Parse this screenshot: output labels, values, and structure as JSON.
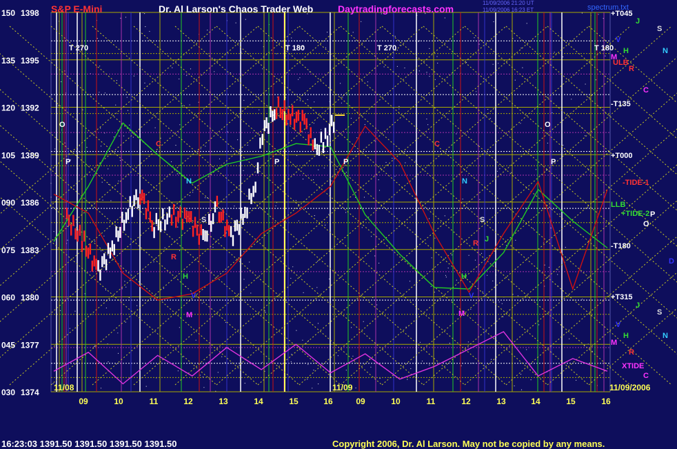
{
  "header": {
    "ticker": "S&P E-Mini",
    "title": "Dr. Al Larson's Chaos Trader Web",
    "site": "Daytradingforecasts.com",
    "stamp1": "11/09/2006 21:20 UT",
    "stamp2": "11/09/2006 16:23 ET",
    "spectrum": "spectrum.txt"
  },
  "footer": {
    "quote": "16:23:03  1391.50  1391.50  1391.50  1391.50",
    "copyright": "Copyright 2006, Dr. Al Larson. May not be copied by any means."
  },
  "colors": {
    "background": "#0e0e5c",
    "grid": "#aaaa00",
    "price_up": "#ffffff",
    "price_down": "#ff0000",
    "green_flux": "#22cc22",
    "red_flux": "#cc1111",
    "cycle": "#dd33dd"
  },
  "chart_data": {
    "type": "line",
    "title": "S&P E-Mini",
    "xlabel": "",
    "ylabel": "",
    "ylim": [
      1374,
      1398
    ],
    "y_ticks": [
      {
        "osc": "150",
        "price": "1398",
        "value": 1398
      },
      {
        "osc": "135",
        "price": "1395",
        "value": 1395
      },
      {
        "osc": "120",
        "price": "1392",
        "value": 1392
      },
      {
        "osc": "105",
        "price": "1389",
        "value": 1389
      },
      {
        "osc": "090",
        "price": "1386",
        "value": 1386
      },
      {
        "osc": "075",
        "price": "1383",
        "value": 1383
      },
      {
        "osc": "060",
        "price": "1380",
        "value": 1380
      },
      {
        "osc": "045",
        "price": "1377",
        "value": 1377
      },
      {
        "osc": "030",
        "price": "1374",
        "value": 1374
      }
    ],
    "x_ticks": [
      "09",
      "10",
      "11",
      "12",
      "13",
      "14",
      "15",
      "16",
      "09",
      "10",
      "11",
      "12",
      "13",
      "14",
      "15",
      "16"
    ],
    "date_labels": [
      "11/08",
      "11/09",
      "11/09/2006"
    ],
    "price_series": [
      {
        "day": "11/08",
        "hour": 8.5,
        "price": 1385.0
      },
      {
        "day": "11/08",
        "hour": 9.0,
        "price": 1383.4
      },
      {
        "day": "11/08",
        "hour": 9.4,
        "price": 1381.6
      },
      {
        "day": "11/08",
        "hour": 9.8,
        "price": 1383.1
      },
      {
        "day": "11/08",
        "hour": 10.2,
        "price": 1385.2
      },
      {
        "day": "11/08",
        "hour": 10.6,
        "price": 1386.6
      },
      {
        "day": "11/08",
        "hour": 11.0,
        "price": 1384.5
      },
      {
        "day": "11/08",
        "hour": 11.5,
        "price": 1385.1
      },
      {
        "day": "11/08",
        "hour": 12.0,
        "price": 1385.0
      },
      {
        "day": "11/08",
        "hour": 12.4,
        "price": 1383.6
      },
      {
        "day": "11/08",
        "hour": 12.8,
        "price": 1385.6
      },
      {
        "day": "11/08",
        "hour": 13.2,
        "price": 1383.8
      },
      {
        "day": "11/08",
        "hour": 13.6,
        "price": 1385.3
      },
      {
        "day": "11/08",
        "hour": 13.9,
        "price": 1387.2
      },
      {
        "day": "11/08",
        "hour": 14.1,
        "price": 1390.4
      },
      {
        "day": "11/08",
        "hour": 14.5,
        "price": 1392.0
      },
      {
        "day": "11/08",
        "hour": 14.9,
        "price": 1391.4
      },
      {
        "day": "11/08",
        "hour": 15.3,
        "price": 1391.1
      },
      {
        "day": "11/08",
        "hour": 15.6,
        "price": 1389.3
      },
      {
        "day": "11/08",
        "hour": 15.9,
        "price": 1389.9
      },
      {
        "day": "11/08",
        "hour": 16.2,
        "price": 1391.5
      }
    ],
    "series": [
      {
        "name": "",
        "color": "#22cc22",
        "values": [
          1383.5,
          1387.0,
          1391.0,
          1389.0,
          1387.2,
          1388.4,
          1388.9,
          1389.7,
          1389.5,
          1385.2,
          1382.7,
          1380.6,
          1380.5,
          1382.8,
          1386.8,
          1384.8,
          1383.1
        ]
      },
      {
        "name": "",
        "color": "#cc1111",
        "values": [
          1386.5,
          1385.3,
          1381.5,
          1379.8,
          1380.2,
          1381.5,
          1384.0,
          1385.3,
          1387.0,
          1390.8,
          1388.5,
          1384.0,
          1380.3,
          1384.0,
          1387.3,
          1380.5,
          1386.8
        ]
      },
      {
        "name": "",
        "color": "#dd33dd",
        "values": [
          1375.3,
          1376.5,
          1374.5,
          1376.3,
          1375.0,
          1376.8,
          1375.4,
          1377.0,
          1375.2,
          1376.4,
          1374.8,
          1375.6,
          1376.7,
          1377.8,
          1375.0,
          1376.1,
          1375.3
        ]
      }
    ],
    "annotations": [
      {
        "text": "T 270",
        "color": "#ffffff"
      },
      {
        "text": "T 180",
        "color": "#ffffff"
      },
      {
        "text": "T 270",
        "color": "#ffffff"
      },
      {
        "text": "T 180",
        "color": "#ffffff"
      },
      {
        "text": "O",
        "color": "#ffffff"
      },
      {
        "text": "P",
        "color": "#ffffff"
      },
      {
        "text": "C",
        "color": "#ff3333"
      },
      {
        "text": "N",
        "color": "#33ccff"
      },
      {
        "text": "S",
        "color": "#dddddd"
      },
      {
        "text": "R",
        "color": "#ff3333"
      },
      {
        "text": "H",
        "color": "#33dd33"
      },
      {
        "text": "V",
        "color": "#3333ff"
      },
      {
        "text": "M",
        "color": "#ff33ff"
      },
      {
        "text": "P",
        "color": "#ffffff"
      },
      {
        "text": "P",
        "color": "#ffffff"
      },
      {
        "text": "C",
        "color": "#ff3333"
      },
      {
        "text": "N",
        "color": "#33ccff"
      },
      {
        "text": "S",
        "color": "#dddddd"
      },
      {
        "text": "R",
        "color": "#ff3333"
      },
      {
        "text": "J",
        "color": "#33dd33"
      },
      {
        "text": "H",
        "color": "#33dd33"
      },
      {
        "text": "V",
        "color": "#3333ff"
      },
      {
        "text": "M",
        "color": "#ff33ff"
      },
      {
        "text": "O",
        "color": "#ffffff"
      },
      {
        "text": "P",
        "color": "#ffffff"
      }
    ],
    "right_labels": [
      {
        "text": "+T045",
        "color": "#ffffff"
      },
      {
        "text": "J",
        "color": "#33dd33"
      },
      {
        "text": "S",
        "color": "#dddddd"
      },
      {
        "text": "V",
        "color": "#3333ff"
      },
      {
        "text": "H",
        "color": "#33dd33"
      },
      {
        "text": "N",
        "color": "#33ccff"
      },
      {
        "text": "M",
        "color": "#ff33ff"
      },
      {
        "text": "ULB",
        "color": "#ff3333"
      },
      {
        "text": "R",
        "color": "#ff3333"
      },
      {
        "text": "C",
        "color": "#ff33ff"
      },
      {
        "text": "-T135",
        "color": "#ffffff"
      },
      {
        "text": "+T000",
        "color": "#ffffff"
      },
      {
        "text": "-TIDE-1",
        "color": "#ff3333"
      },
      {
        "text": "LLB",
        "color": "#33dd33"
      },
      {
        "text": "+TIDE-2",
        "color": "#33dd33"
      },
      {
        "text": "P",
        "color": "#ffffff"
      },
      {
        "text": "O",
        "color": "#ffffff"
      },
      {
        "text": "-T180",
        "color": "#ffffff"
      },
      {
        "text": "D",
        "color": "#3333ff"
      },
      {
        "text": "+T315",
        "color": "#ffffff"
      },
      {
        "text": "J",
        "color": "#33dd33"
      },
      {
        "text": "S",
        "color": "#dddddd"
      },
      {
        "text": "V",
        "color": "#3333ff"
      },
      {
        "text": "H",
        "color": "#33dd33"
      },
      {
        "text": "N",
        "color": "#33ccff"
      },
      {
        "text": "M",
        "color": "#ff33ff"
      },
      {
        "text": "R",
        "color": "#ff3333"
      },
      {
        "text": "XTIDE",
        "color": "#ff33ff"
      },
      {
        "text": "C",
        "color": "#ff33ff"
      }
    ]
  }
}
